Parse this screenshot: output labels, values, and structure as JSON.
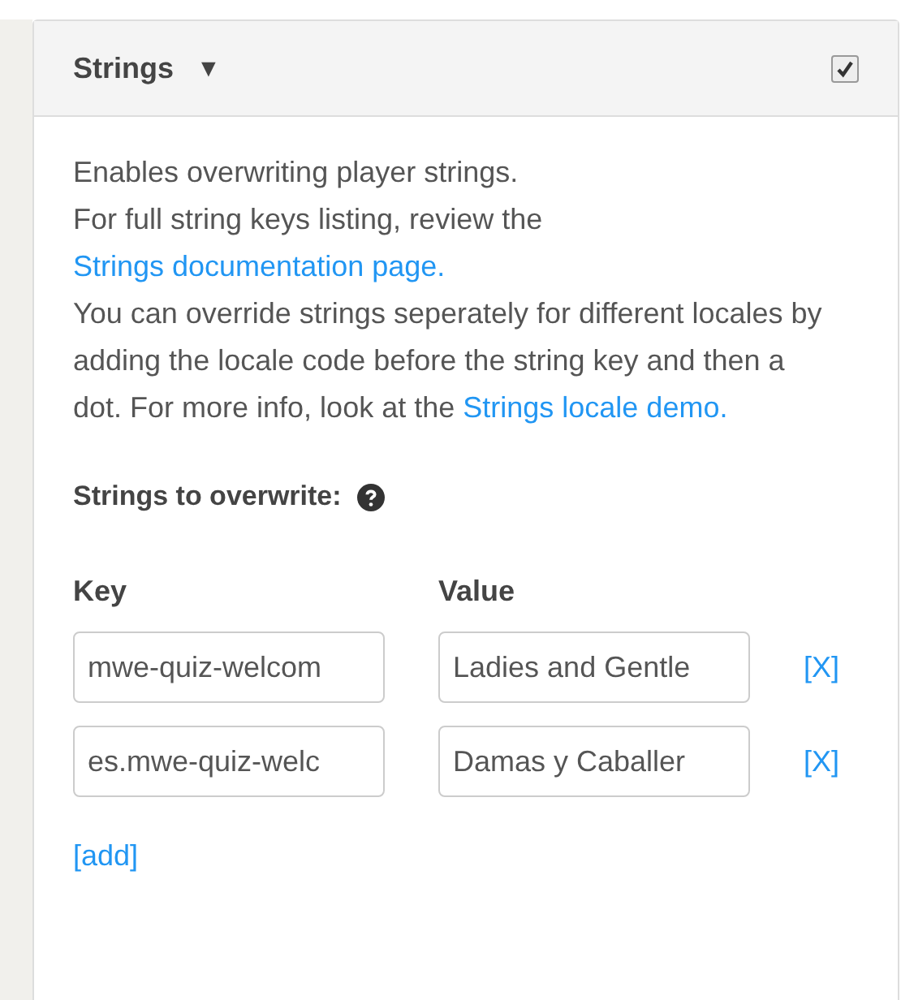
{
  "panel": {
    "title": "Strings",
    "caret": "▼",
    "enabled": {
      "checked": true
    }
  },
  "description": [
    {
      "text": "Enables overwriting player strings."
    },
    {
      "text": "For full string keys listing, review the ",
      "link": "Strings documentation page."
    },
    {
      "text": "You can override strings seperately for different locales by adding the locale code before the string key and then a dot. For more info, look at the ",
      "link": "Strings locale demo."
    }
  ],
  "strings_label": "Strings to overwrite:",
  "columns": [
    "Key",
    "Value"
  ],
  "rows": [
    {
      "key": "mwe-quiz-welcom",
      "value": "Ladies and Gentle",
      "remove": "[X]"
    },
    {
      "key": "es.mwe-quiz-welc",
      "value": "Damas y Caballer",
      "remove": "[X]"
    }
  ],
  "add": "[add]"
}
